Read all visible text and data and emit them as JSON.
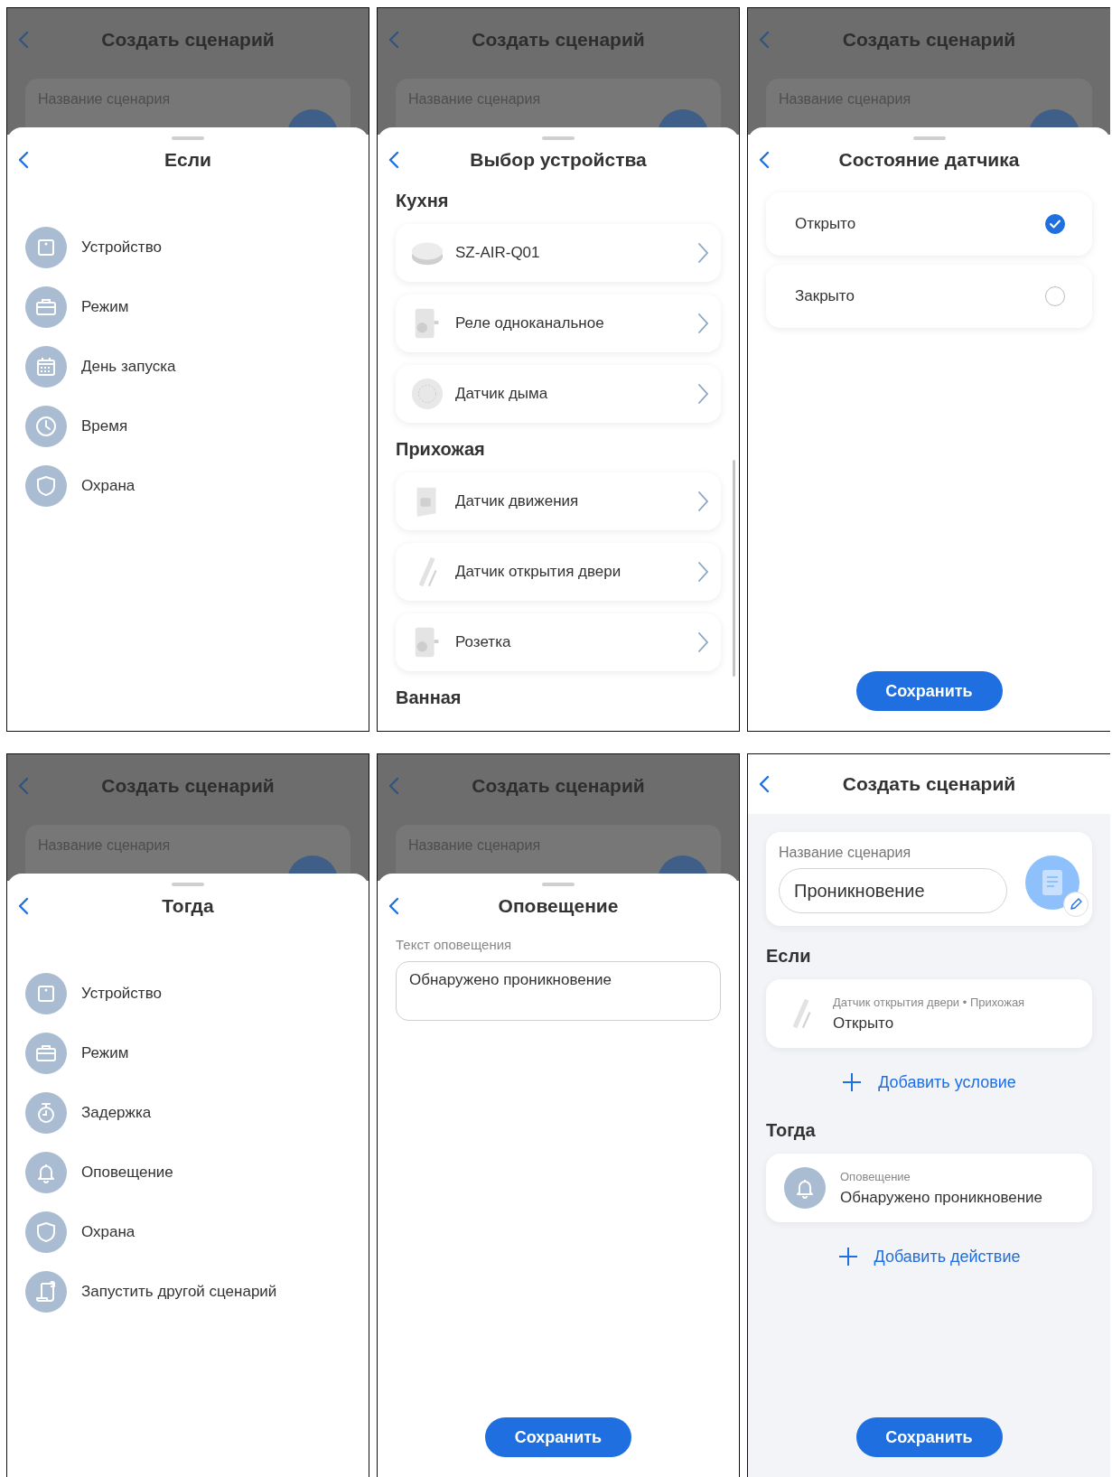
{
  "screens": [
    {
      "kind": "menu",
      "backdrop": {
        "title": "Создать сценарий",
        "field_label": "Название сценария"
      },
      "title": "Если",
      "items": [
        {
          "kind": "device",
          "label": "Устройство"
        },
        {
          "kind": "mode",
          "label": "Режим"
        },
        {
          "kind": "day",
          "label": "День запуска"
        },
        {
          "kind": "time",
          "label": "Время"
        },
        {
          "kind": "security",
          "label": "Охрана"
        }
      ]
    },
    {
      "kind": "devices",
      "backdrop": {
        "title": "Создать сценарий",
        "field_label": "Название сценария"
      },
      "title": "Выбор устройства",
      "groups": [
        {
          "name": "Кухня",
          "devices": [
            {
              "kind": "hub",
              "label": "SZ-AIR-Q01"
            },
            {
              "kind": "plug",
              "label": "Реле одноканальное"
            },
            {
              "kind": "smoke",
              "label": "Датчик дыма"
            }
          ]
        },
        {
          "name": "Прихожая",
          "devices": [
            {
              "kind": "motion",
              "label": "Датчик движения"
            },
            {
              "kind": "door",
              "label": "Датчик открытия двери"
            },
            {
              "kind": "plug",
              "label": "Розетка"
            }
          ]
        },
        {
          "name": "Ванная"
        }
      ]
    },
    {
      "kind": "state",
      "backdrop": {
        "title": "Создать сценарий",
        "field_label": "Название сценария"
      },
      "title": "Состояние датчика",
      "options": [
        {
          "label": "Открыто",
          "selected": true
        },
        {
          "label": "Закрыто",
          "selected": false
        }
      ],
      "save": "Сохранить"
    },
    {
      "kind": "menu",
      "backdrop": {
        "title": "Создать сценарий",
        "field_label": "Название сценария"
      },
      "title": "Тогда",
      "items": [
        {
          "kind": "device",
          "label": "Устройство"
        },
        {
          "kind": "mode",
          "label": "Режим"
        },
        {
          "kind": "delay",
          "label": "Задержка"
        },
        {
          "kind": "notification",
          "label": "Оповещение"
        },
        {
          "kind": "security",
          "label": "Охрана"
        },
        {
          "kind": "scenario",
          "label": "Запустить другой сценарий"
        }
      ]
    },
    {
      "kind": "notification",
      "backdrop": {
        "title": "Создать сценарий",
        "field_label": "Название сценария"
      },
      "title": "Оповещение",
      "field_label": "Текст оповещения",
      "value": "Обнаружено проникновение",
      "save": "Сохранить"
    },
    {
      "kind": "scenario",
      "title": "Создать сценарий",
      "name_label": "Название сценария",
      "name_value": "Проникновение",
      "sections": [
        {
          "heading": "Если",
          "card": {
            "kind": "door",
            "caption": "Датчик открытия двери • Прихожая",
            "value": "Открыто"
          },
          "add": "Добавить условие"
        },
        {
          "heading": "Тогда",
          "card": {
            "kind": "notification",
            "caption": "Оповещение",
            "value": "Обнаружено проникновение"
          },
          "add": "Добавить действие"
        }
      ],
      "save": "Сохранить"
    }
  ]
}
